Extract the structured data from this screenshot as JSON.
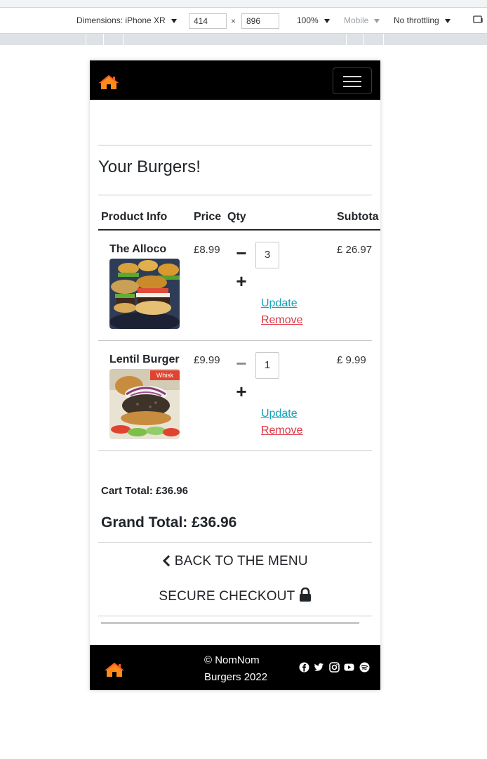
{
  "devtools": {
    "dimensions_label": "Dimensions: iPhone XR",
    "width": "414",
    "height": "896",
    "times": "×",
    "zoom": "100%",
    "mobile": "Mobile",
    "throttling": "No throttling"
  },
  "navbar": {
    "logo_icon": "home-icon",
    "toggle_icon": "hamburger-icon",
    "logo_color": "#ff7a1a"
  },
  "cart": {
    "title": "Your Burgers!",
    "headers": {
      "product": "Product Info",
      "price": "Price",
      "qty": "Qty",
      "subtotal": "Subtota"
    },
    "items": [
      {
        "name": "The Alloco",
        "price": "£8.99",
        "qty": "3",
        "decrement": "−",
        "increment": "+",
        "update": "Update",
        "remove": "Remove",
        "subtotal": "£ 26.97"
      },
      {
        "name": "Lentil Burger",
        "price": "£9.99",
        "qty": "1",
        "decrement": "−",
        "increment": "+",
        "update": "Update",
        "remove": "Remove",
        "subtotal": "£ 9.99",
        "image_text": "Whisk"
      }
    ],
    "cart_total": "Cart Total: £36.96",
    "grand_total": "Grand Total: £36.96",
    "back_button": "BACK TO THE MENU",
    "checkout_button": "SECURE CHECKOUT"
  },
  "footer": {
    "copyright": "© NomNom Burgers 2022",
    "socials": [
      "facebook-icon",
      "twitter-icon",
      "instagram-icon",
      "youtube-icon",
      "spotify-icon"
    ]
  },
  "colors": {
    "update_link": "#17a2b8",
    "remove_link": "#dc3545",
    "nav_bg": "#000000"
  }
}
